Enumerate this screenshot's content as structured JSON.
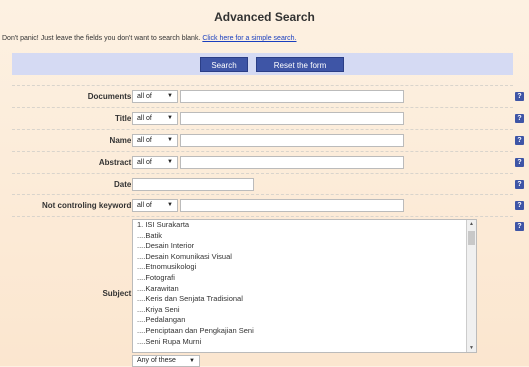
{
  "page": {
    "title": "Advanced Search"
  },
  "intro": {
    "text": "Don't panic! Just leave the fields you don't want to search blank.",
    "link": "Click here for a simple search."
  },
  "buttons": {
    "search": "Search",
    "reset": "Reset the form"
  },
  "fields": [
    {
      "label": "Documents:",
      "match": "all of"
    },
    {
      "label": "Title:",
      "match": "all of"
    },
    {
      "label": "Name:",
      "match": "all of"
    },
    {
      "label": "Abstract:",
      "match": "all of"
    },
    {
      "label": "Date:"
    },
    {
      "label": "Not controling keyword:",
      "match": "all of"
    }
  ],
  "subject": {
    "label": "Subject:",
    "options": [
      "1. ISI Surakarta",
      "....Batik",
      "....Desain Interior",
      "....Desain Komunikasi Visual",
      "....Etnomusikologi",
      "....Fotografi",
      "....Karawitan",
      "....Keris dan Senjata Tradisional",
      "....Kriya Seni",
      "....Pedalangan",
      "....Penciptaan dan Pengkajian Seni",
      "....Seni Rupa Murni"
    ],
    "match": "Any of these"
  },
  "icons": {
    "help": "help-icon",
    "dropdown": "chevron-down-icon"
  },
  "colors": {
    "button": "#3e55a6",
    "bar": "#d5daf3",
    "link": "#1a3fbf"
  }
}
